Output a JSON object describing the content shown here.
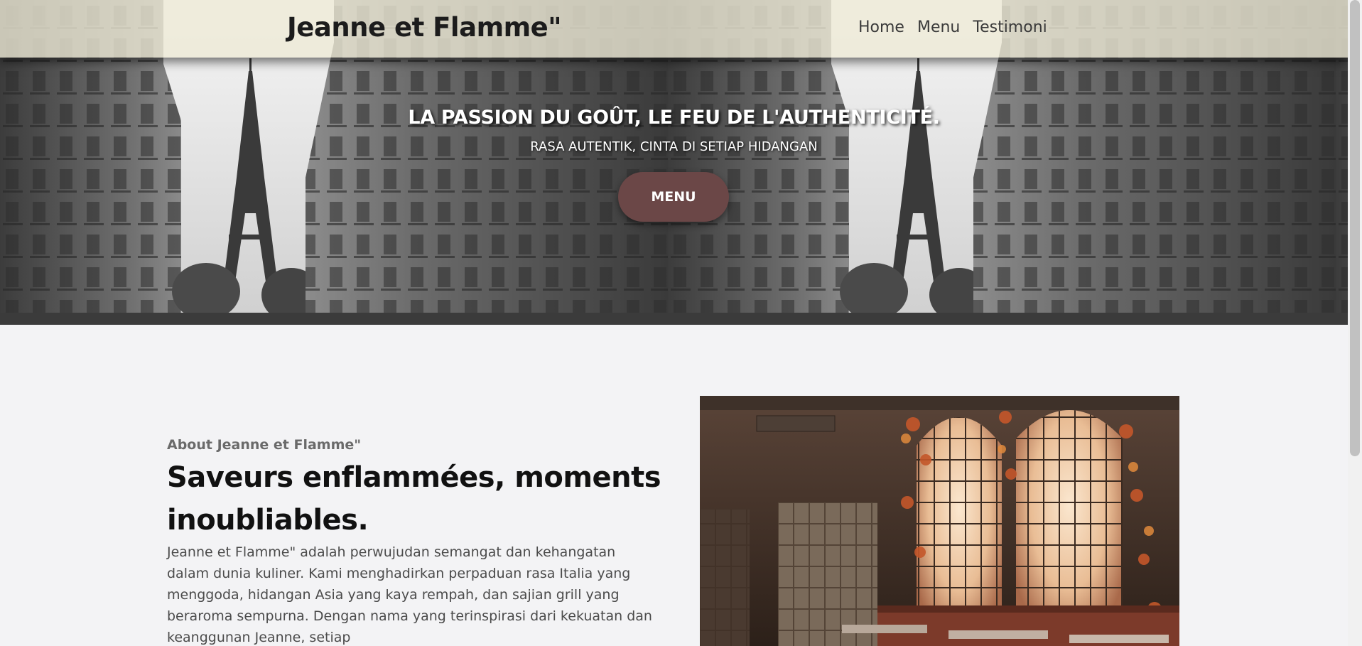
{
  "nav": {
    "brand": "Jeanne et Flamme\"",
    "links": [
      "Home",
      "Menu",
      "Testimoni"
    ]
  },
  "hero": {
    "title": "LA PASSION DU GOÛT, LE FEU DE L'AUTHENTICITÉ.",
    "subtitle": "RASA AUTENTIK, CINTA DI SETIAP HIDANGAN",
    "button_label": "MENU",
    "image_icon": "paris-street-eiffel-tower-photo"
  },
  "about": {
    "kicker": "About Jeanne et Flamme\"",
    "heading": "Saveurs enflammées, moments inoubliables.",
    "text": "Jeanne et Flamme\" adalah perwujudan semangat dan kehangatan dalam dunia kuliner. Kami menghadirkan perpaduan rasa Italia yang menggoda, hidangan Asia yang kaya rempah, dan sajian grill yang beraroma sempurna. Dengan nama yang terinspirasi dari kekuatan dan keanggunan Jeanne, setiap",
    "image_icon": "restaurant-interior-photo"
  },
  "colors": {
    "nav_bg": "#eeead6",
    "button_bg": "#6b4747",
    "page_bg": "#f3f3f5",
    "heading": "#111111",
    "body_text": "#4b4b4b"
  }
}
